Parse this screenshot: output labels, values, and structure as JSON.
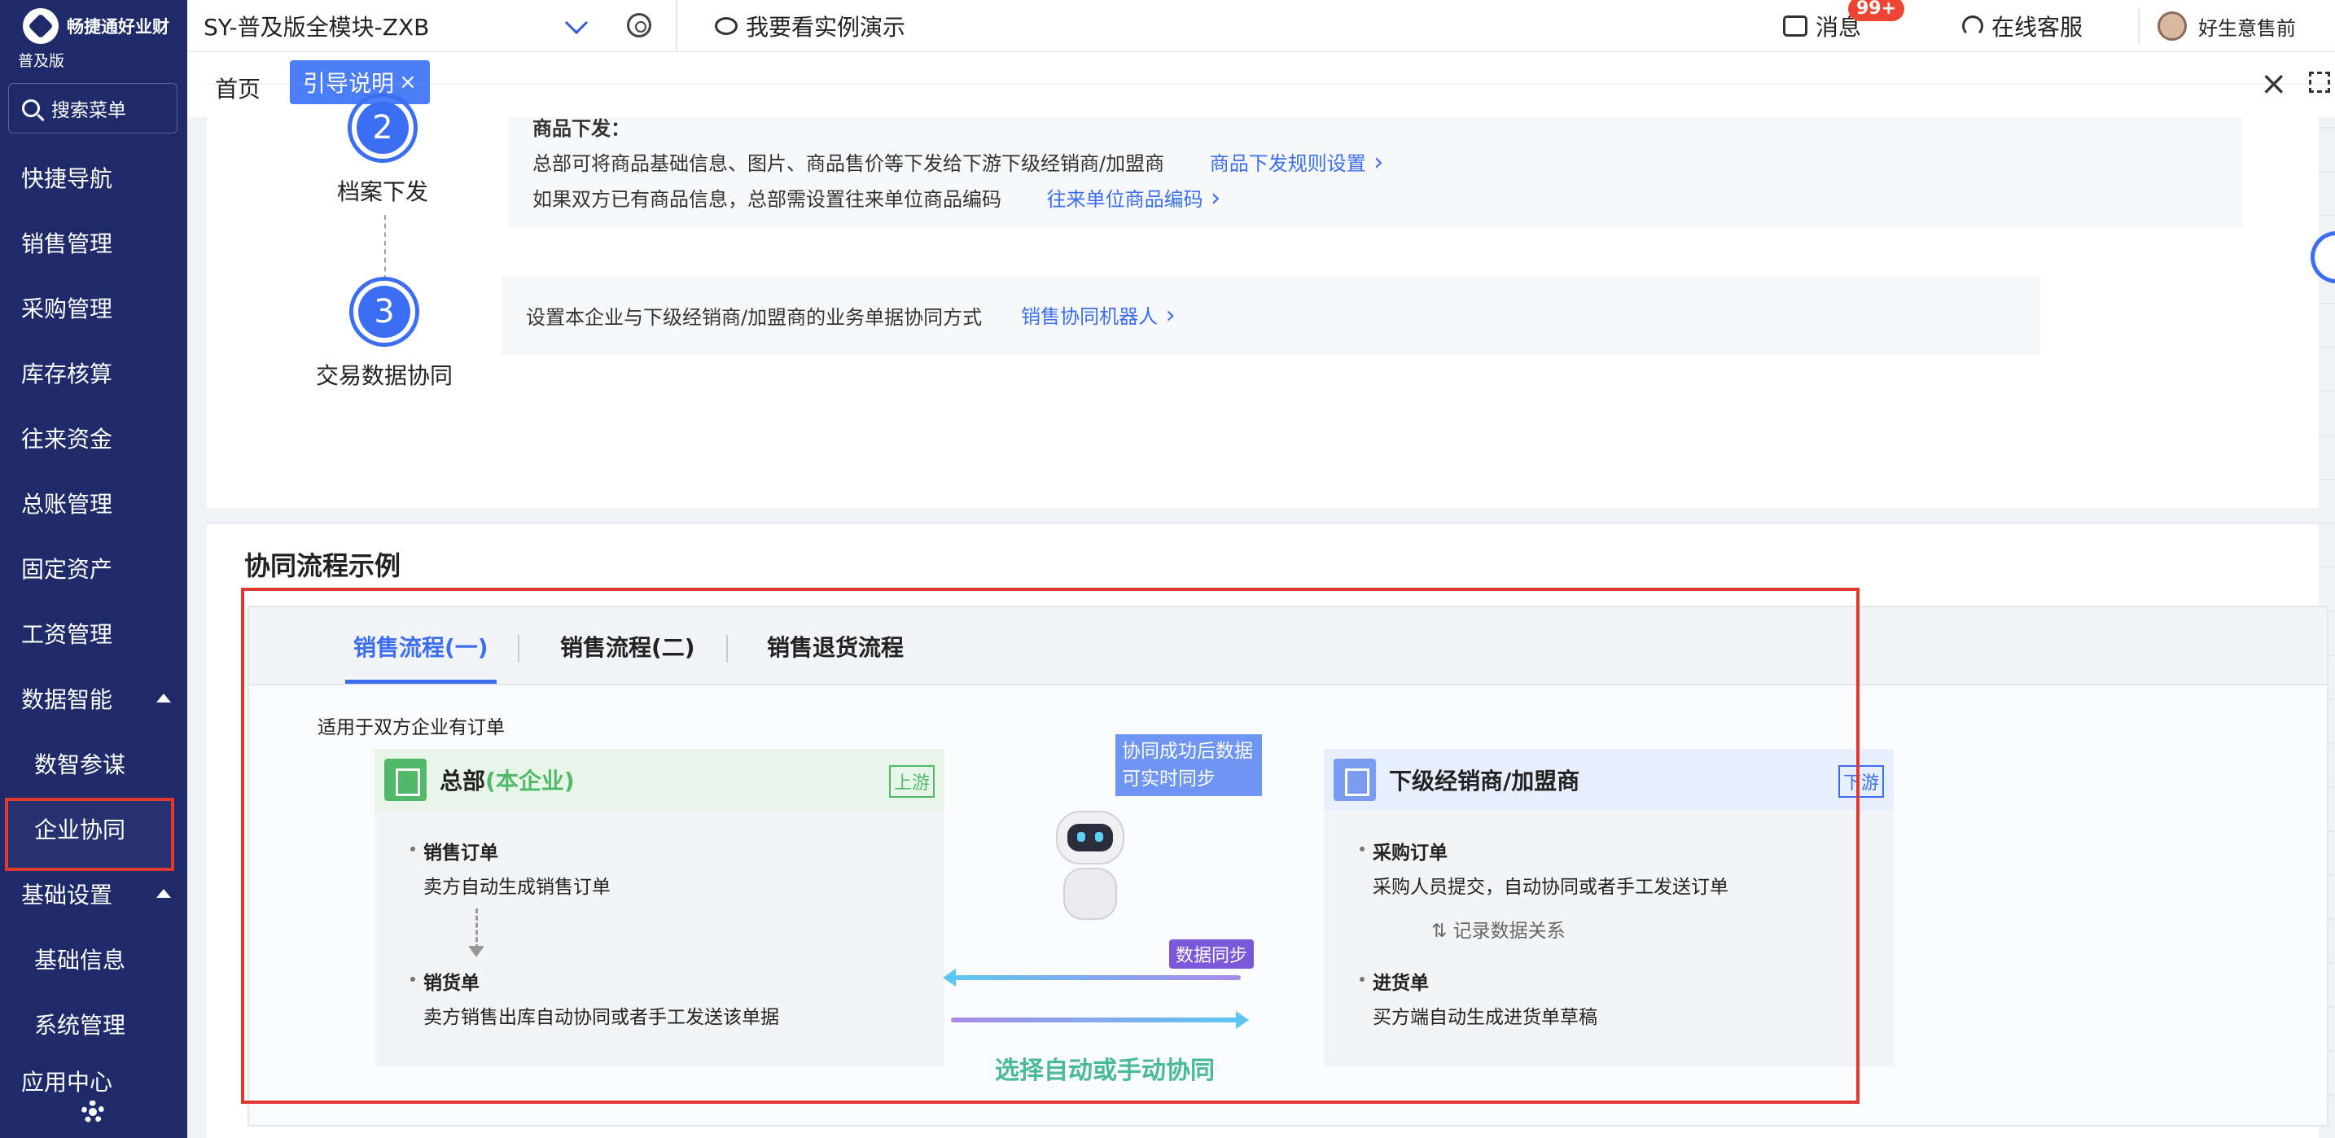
{
  "app": {
    "logo_text": "畅捷通好业财",
    "edition": "普及版",
    "search_label": "搜索菜单"
  },
  "sidebar": {
    "items": [
      {
        "label": "快捷导航"
      },
      {
        "label": "销售管理"
      },
      {
        "label": "采购管理"
      },
      {
        "label": "库存核算"
      },
      {
        "label": "往来资金"
      },
      {
        "label": "总账管理"
      },
      {
        "label": "固定资产"
      },
      {
        "label": "工资管理"
      },
      {
        "label": "数据智能"
      },
      {
        "label": "数智参谋"
      },
      {
        "label": "企业协同"
      },
      {
        "label": "基础设置"
      },
      {
        "label": "基础信息"
      },
      {
        "label": "系统管理"
      },
      {
        "label": "应用中心"
      }
    ]
  },
  "topbar": {
    "account": "SY-普及版全模块-ZXB",
    "demo": "我要看实例演示",
    "messages": "消息",
    "badge": "99+",
    "service": "在线客服",
    "user": "好生意售前"
  },
  "tabs": {
    "home": "首页",
    "guide": "引导说明",
    "close": "×"
  },
  "steps": {
    "s2": {
      "num": "2",
      "label": "档案下发",
      "title": "商品下发：",
      "line1": "总部可将商品基础信息、图片、商品售价等下发给下游下级经销商/加盟商",
      "link1": "商品下发规则设置",
      "line2": "如果双方已有商品信息，总部需设置往来单位商品编码",
      "link2": "往来单位商品编码"
    },
    "s3": {
      "num": "3",
      "label": "交易数据协同",
      "line1": "设置本企业与下级经销商/加盟商的业务单据协同方式",
      "link1": "销售协同机器人"
    }
  },
  "flow": {
    "section_title": "协同流程示例",
    "tabs": [
      "销售流程(一)",
      "销售流程(二)",
      "销售退货流程"
    ],
    "applies": "适用于双方企业有订单",
    "left": {
      "name": "总部",
      "name_hl": "(本企业)",
      "tag": "上游",
      "node1_title": "销售订单",
      "node1_desc": "卖方自动生成销售订单",
      "node2_title": "销货单",
      "node2_desc": "卖方销售出库自动协同或者手工发送该单据"
    },
    "right": {
      "name": "下级经销商/加盟商",
      "tag": "下游",
      "node1_title": "采购订单",
      "node1_desc": "采购人员提交，自动协同或者手工发送订单",
      "record": "记录数据关系",
      "node2_title": "进货单",
      "node2_desc": "买方端自动生成进货单草稿"
    },
    "bubble": "协同成功后数据可实时同步",
    "sync_badge": "数据同步",
    "choose": "选择自动或手动协同"
  },
  "colors": {
    "sidebar_bg": "#1f2a6b",
    "accent": "#3b6ef3",
    "highlight_red": "#e03a2f",
    "upstream_green": "#53b96a",
    "choose_green": "#48b999"
  }
}
